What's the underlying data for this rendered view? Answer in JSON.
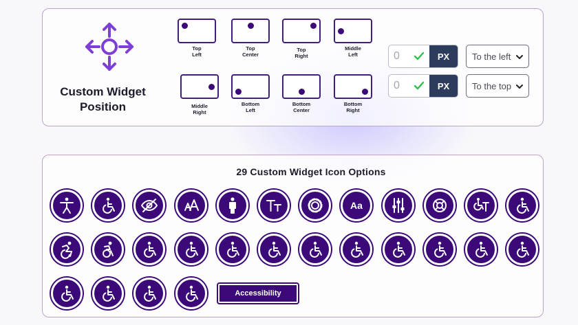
{
  "widget_position": {
    "title": "Custom Widget Position",
    "options": [
      {
        "label_top": "Top",
        "label_bottom": "Left"
      },
      {
        "label_top": "Top",
        "label_bottom": "Center"
      },
      {
        "label_top": "Top",
        "label_bottom": "Right"
      },
      {
        "label_top": "Middle",
        "label_bottom": "Left"
      },
      {
        "label_top": "Middle",
        "label_bottom": "Right"
      },
      {
        "label_top": "Bottom",
        "label_bottom": "Left"
      },
      {
        "label_top": "Bottom",
        "label_bottom": "Center"
      },
      {
        "label_top": "Bottom",
        "label_bottom": "Right"
      }
    ],
    "offsets": [
      {
        "value": "0",
        "unit": "PX",
        "direction": "To the left"
      },
      {
        "value": "0",
        "unit": "PX",
        "direction": "To the top"
      }
    ]
  },
  "icon_options": {
    "title": "29 Custom Widget Icon Options",
    "button_label": "Accessibility",
    "icons": [
      "accessibility-person-icon",
      "wheelchair-icon",
      "eye-slash-icon",
      "text-size-icon",
      "person-icon",
      "text-format-icon",
      "gear-icon",
      "font-aa-icon",
      "sliders-icon",
      "lifebuoy-icon",
      "wheelchair-desk-icon",
      "wheelchair-icon",
      "active-wheelchair-icon",
      "active-wheelchair-alt-icon",
      "wheelchair-icon",
      "wheelchair-icon",
      "wheelchair-icon",
      "wheelchair-icon",
      "wheelchair-icon",
      "wheelchair-icon",
      "wheelchair-icon",
      "wheelchair-icon",
      "wheelchair-icon",
      "wheelchair-icon",
      "wheelchair-icon",
      "wheelchair-icon",
      "wheelchair-icon",
      "wheelchair-icon"
    ]
  },
  "colors": {
    "brand": "#3b0a78",
    "px_unit_bg": "#2d3c5c",
    "check": "#2fbf4a",
    "panel_border": "#b9a3d3"
  }
}
